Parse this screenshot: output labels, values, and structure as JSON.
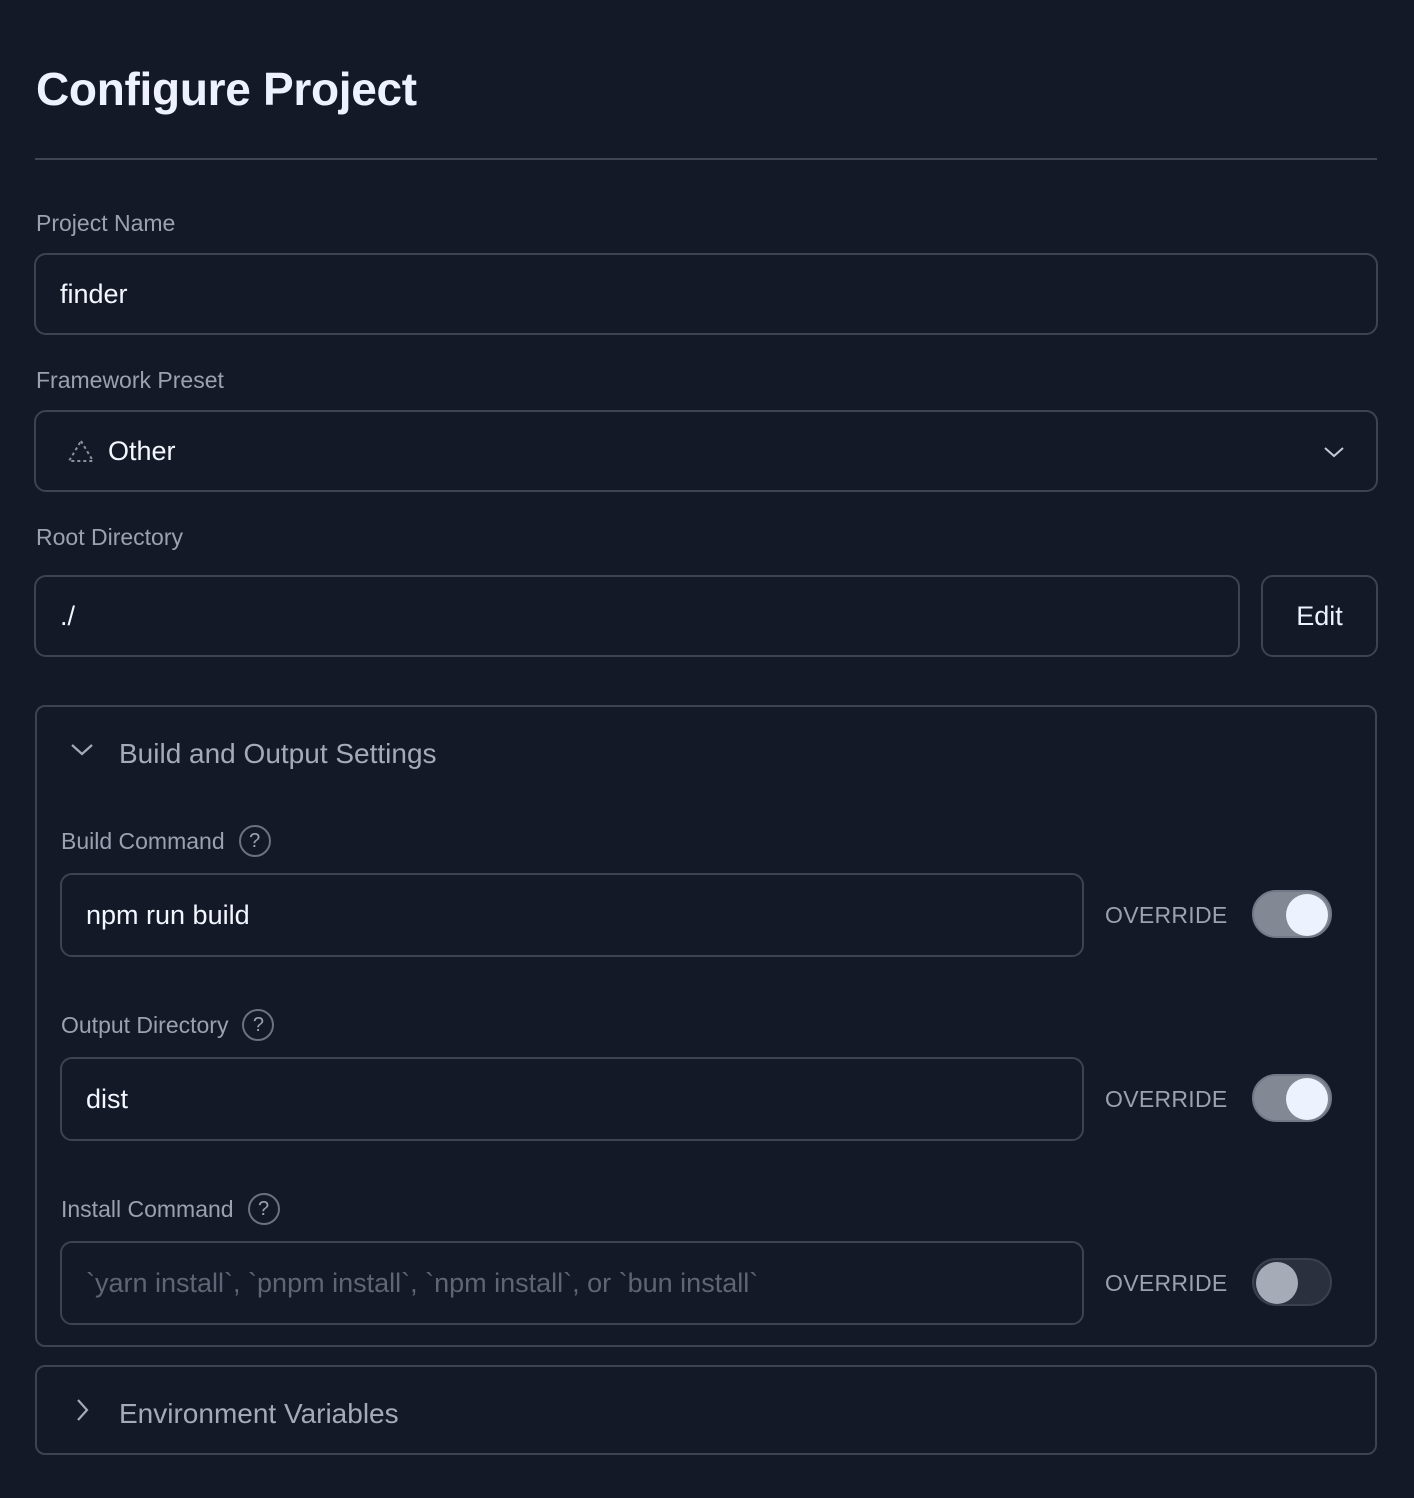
{
  "header": {
    "title": "Configure Project"
  },
  "project_name": {
    "label": "Project Name",
    "value": "finder"
  },
  "framework_preset": {
    "label": "Framework Preset",
    "value": "Other",
    "icon": "triangle-dashed-icon"
  },
  "root_directory": {
    "label": "Root Directory",
    "value": "./",
    "edit_label": "Edit"
  },
  "build_settings": {
    "title": "Build and Output Settings",
    "expanded": true,
    "build_command": {
      "label": "Build Command",
      "value": "npm run build",
      "override_label": "OVERRIDE",
      "override": true
    },
    "output_directory": {
      "label": "Output Directory",
      "value": "dist",
      "override_label": "OVERRIDE",
      "override": true
    },
    "install_command": {
      "label": "Install Command",
      "placeholder": "`yarn install`, `pnpm install`, `npm install`, or `bun install`",
      "override_label": "OVERRIDE",
      "override": false
    },
    "help_glyph": "?"
  },
  "environment_variables": {
    "title": "Environment Variables",
    "expanded": false
  }
}
